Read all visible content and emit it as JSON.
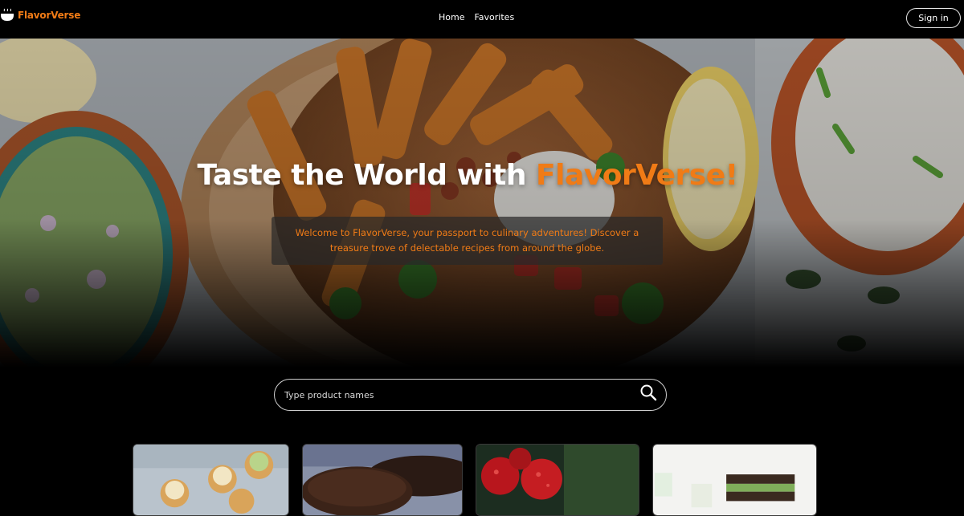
{
  "brand": {
    "name": "FlavorVerse",
    "icon": "cooking-pot-icon",
    "accent_color": "#f07b16"
  },
  "nav": {
    "links": [
      "Home",
      "Favorites"
    ],
    "signin_label": "Sign in"
  },
  "hero": {
    "title_prefix": "Taste the World with ",
    "title_accent": "FlavorVerse!",
    "intro": "Welcome to FlavorVerse, your passport to culinary adventures! Discover a treasure trove of delectable recipes from around the globe."
  },
  "search": {
    "placeholder": "Type product names",
    "value": "",
    "icon": "search-icon"
  },
  "recipe_cards": [
    {
      "image": "pistachio-cupcakes-photo"
    },
    {
      "image": "chocolate-cake-photo"
    },
    {
      "image": "red-ornaments-photo"
    },
    {
      "image": "tea-sandwiches-photo"
    }
  ]
}
